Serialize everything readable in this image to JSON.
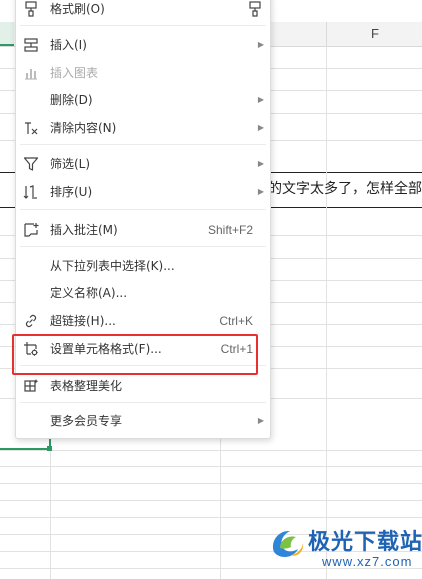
{
  "sheet": {
    "column_header_f": "F",
    "cell_text": "的文字太多了，怎样全部",
    "accent_color": "#2c9b63"
  },
  "menu": {
    "items": [
      {
        "label": "格式刷(O)"
      },
      {
        "label": "插入(I)",
        "has_submenu": true
      },
      {
        "label": "插入图表",
        "disabled": true
      },
      {
        "label": "删除(D)",
        "has_submenu": true
      },
      {
        "label": "清除内容(N)",
        "has_submenu": true
      },
      {
        "label": "筛选(L)",
        "has_submenu": true
      },
      {
        "label": "排序(U)",
        "has_submenu": true
      },
      {
        "label": "插入批注(M)",
        "shortcut": "Shift+F2"
      },
      {
        "label": "从下拉列表中选择(K)..."
      },
      {
        "label": "定义名称(A)..."
      },
      {
        "label": "超链接(H)...",
        "shortcut": "Ctrl+K"
      },
      {
        "label": "设置单元格格式(F)...",
        "shortcut": "Ctrl+1",
        "highlighted": true
      },
      {
        "label": "表格整理美化"
      },
      {
        "label": "更多会员专享",
        "has_submenu": true
      }
    ],
    "submenu_arrow": "▶"
  },
  "highlight_color": "#e8312f",
  "watermark": {
    "title": "极光下载站",
    "url": "www.xz7.com"
  }
}
